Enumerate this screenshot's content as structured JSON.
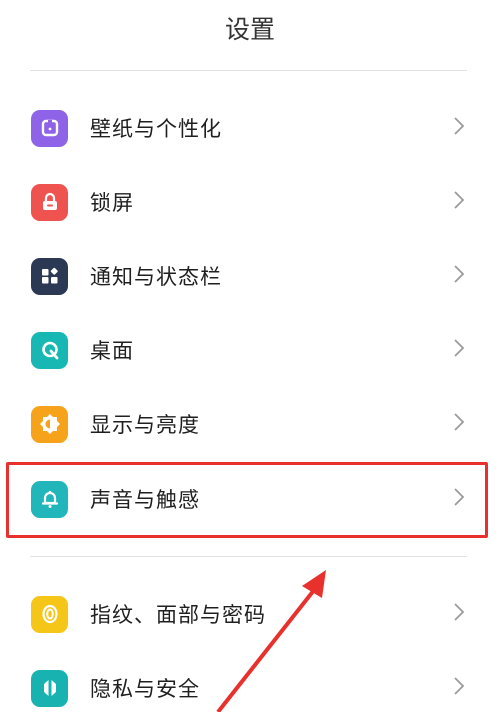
{
  "header": {
    "title": "设置"
  },
  "settings": {
    "items": [
      {
        "label": "壁纸与个性化",
        "icon": "wallpaper-icon",
        "color": "#8e63e8"
      },
      {
        "label": "锁屏",
        "icon": "lock-icon",
        "color": "#ef5350"
      },
      {
        "label": "通知与状态栏",
        "icon": "notification-grid-icon",
        "color": "#2b3954"
      },
      {
        "label": "桌面",
        "icon": "desktop-q-icon",
        "color": "#17b8b3"
      },
      {
        "label": "显示与亮度",
        "icon": "brightness-icon",
        "color": "#f7a21b"
      },
      {
        "label": "声音与触感",
        "icon": "bell-icon",
        "color": "#21b6ba"
      },
      {
        "label": "指纹、面部与密码",
        "icon": "fingerprint-icon",
        "color": "#f5c518"
      },
      {
        "label": "隐私与安全",
        "icon": "privacy-icon",
        "color": "#18b3b0"
      }
    ]
  },
  "annotation": {
    "highlight_color": "#e8302c",
    "highlighted_item": "声音与触感"
  }
}
